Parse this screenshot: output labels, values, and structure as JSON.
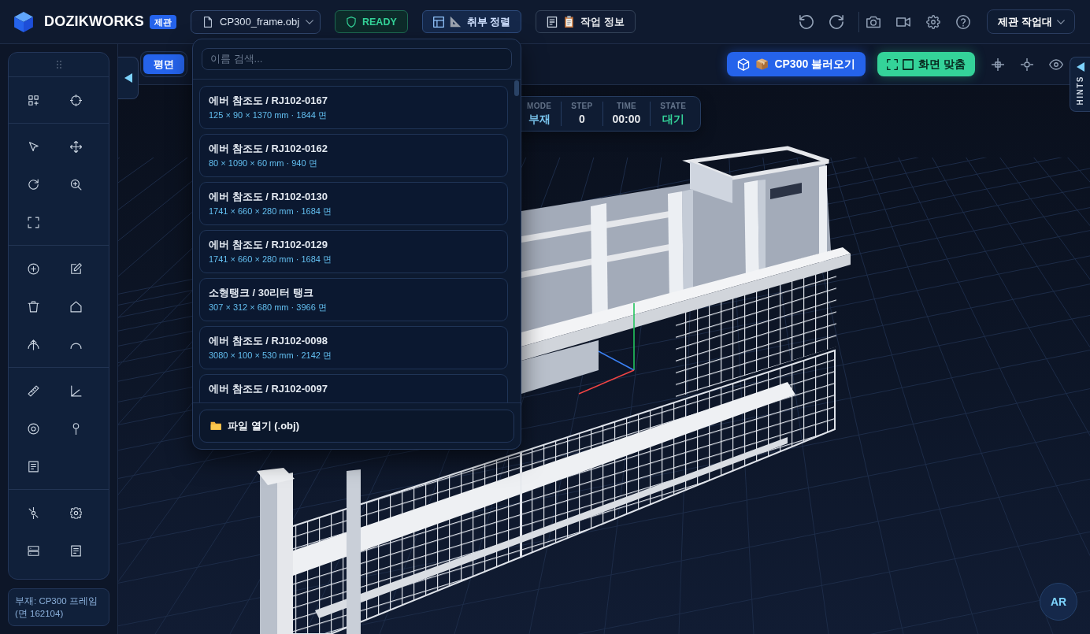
{
  "header": {
    "brand": "DOZIKWORKS",
    "badge": "제관",
    "file_menu": {
      "label": "CP300_frame.obj",
      "expanded": true
    },
    "status": "READY",
    "buttons": [
      {
        "label": "취부 정렬",
        "kind": "accent"
      },
      {
        "label": "작업 정보",
        "kind": "plain"
      }
    ],
    "workspace": "제관 작업대"
  },
  "file_dropdown": {
    "search_placeholder": "이름 검색...",
    "items": [
      {
        "title": "에버 참조도 / RJ102-0167",
        "detail": "125 × 90 × 1370 mm · 1844 면"
      },
      {
        "title": "에버 참조도 / RJ102-0162",
        "detail": "80 × 1090 × 60 mm · 940 면"
      },
      {
        "title": "에버 참조도 / RJ102-0130",
        "detail": "1741 × 660 × 280 mm · 1684 면"
      },
      {
        "title": "에버 참조도 / RJ102-0129",
        "detail": "1741 × 660 × 280 mm · 1684 면"
      },
      {
        "title": "소형탱크 / 30리터 탱크",
        "detail": "307 × 312 × 680 mm · 3966 면"
      },
      {
        "title": "에버 참조도 / RJ102-0098",
        "detail": "3080 × 100 × 530 mm · 2142 면"
      },
      {
        "title": "에버 참조도 / RJ102-0097"
      }
    ],
    "open_button": "파일 열기 (.obj)"
  },
  "part_info": "부재: CP300 프레임 (면 162104)",
  "view_tabs": [
    {
      "label": "평면",
      "selected": true
    }
  ],
  "viewport_buttons": {
    "load": "CP300 불러오기",
    "fit": "화면 맞춤"
  },
  "hints_tab": "HINTS",
  "hud": [
    {
      "label": "MODE",
      "value": "부재",
      "color": "#7cc8f2"
    },
    {
      "label": "STEP",
      "value": "0",
      "color": "#e5e7eb"
    },
    {
      "label": "TIME",
      "value": "00:00",
      "color": "#e5e7eb"
    },
    {
      "label": "STATE",
      "value": "대기",
      "color": "#34d399"
    }
  ],
  "ar_button": "AR"
}
